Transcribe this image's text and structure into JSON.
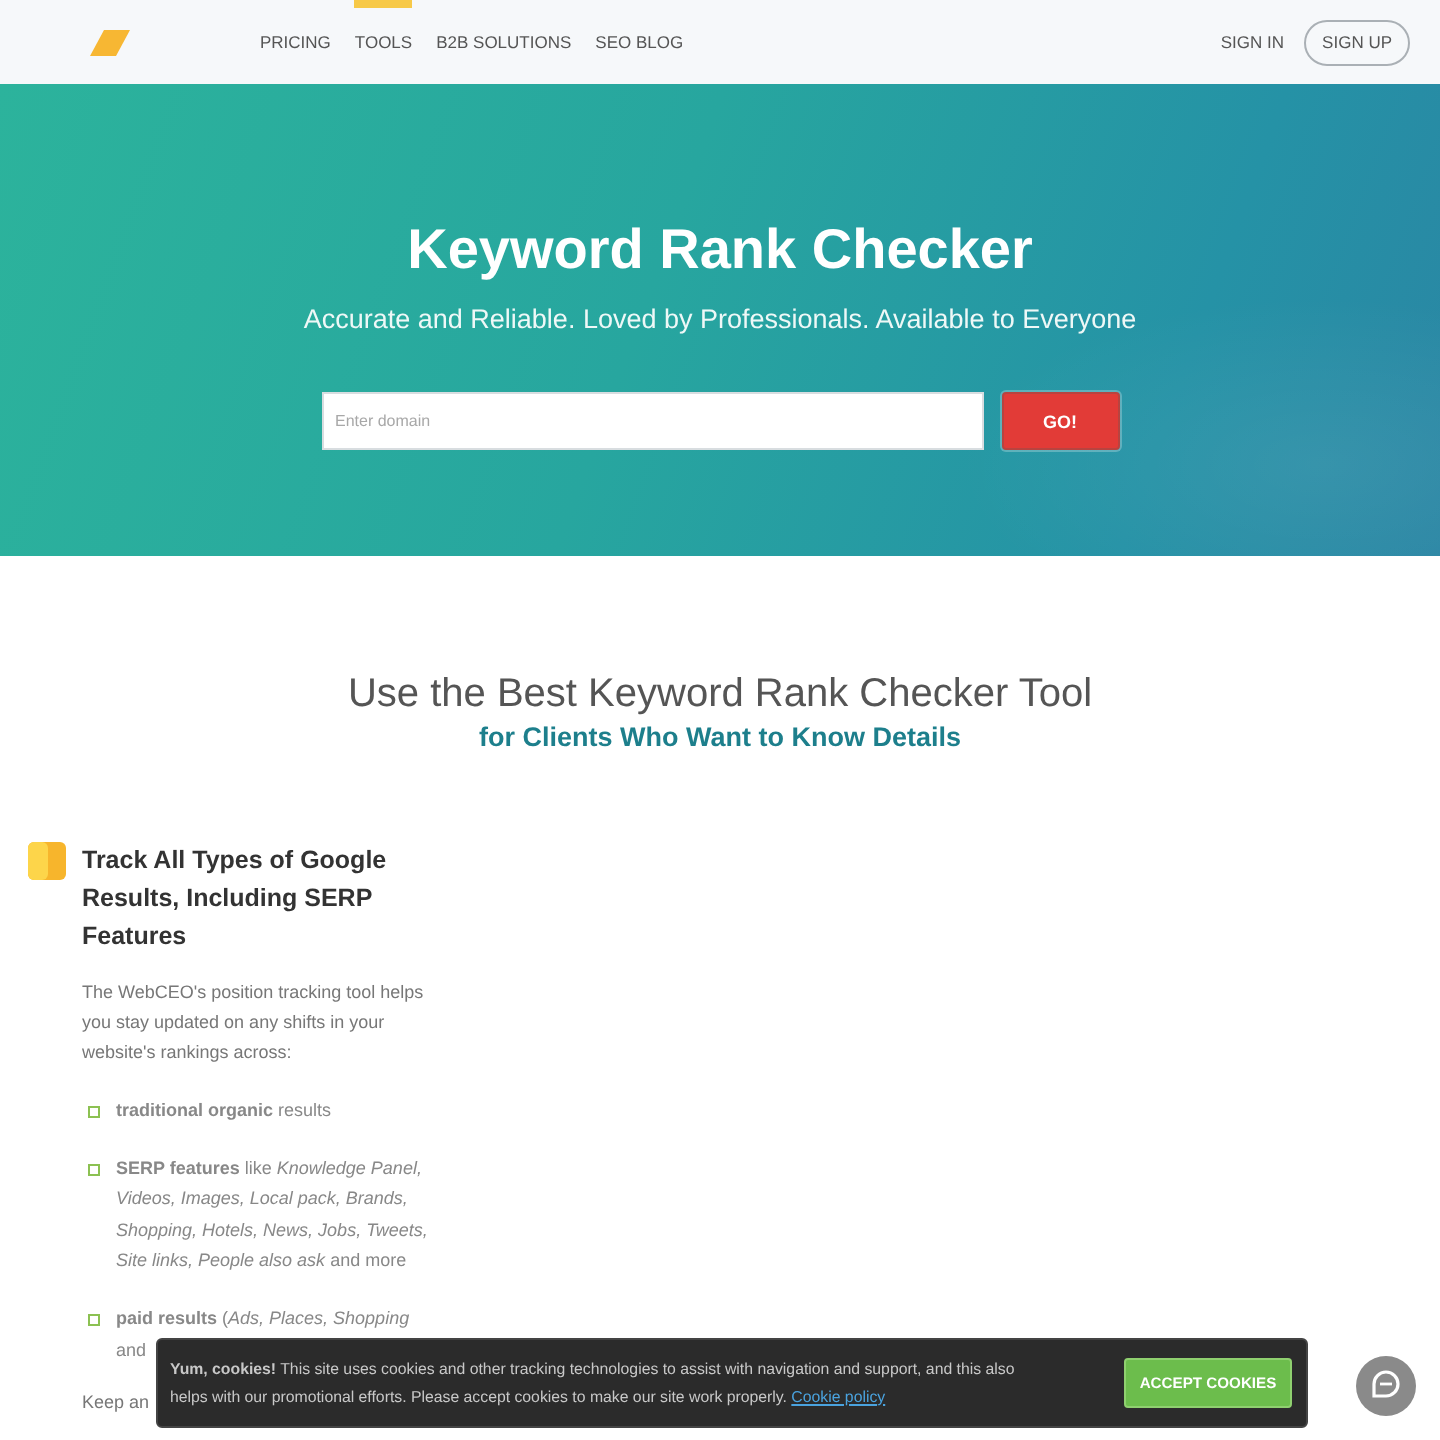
{
  "header": {
    "nav": [
      {
        "label": "PRICING",
        "selected": false
      },
      {
        "label": "TOOLS",
        "selected": true
      },
      {
        "label": "B2B SOLUTIONS",
        "selected": false
      },
      {
        "label": "SEO BLOG",
        "selected": false
      }
    ],
    "sign_in": "SIGN IN",
    "sign_up": "SIGN UP"
  },
  "hero": {
    "title": "Keyword Rank Checker",
    "subtitle": "Accurate and Reliable. Loved by Professionals. Available to Everyone",
    "search": {
      "placeholder": "Enter domain"
    },
    "button": "GO!"
  },
  "section": {
    "title": "Use the Best Keyword Rank Checker Tool",
    "subtitle": "for Clients Who Want to Know Details"
  },
  "feature": {
    "heading": "Track All Types of Google Results, Including SERP Features",
    "intro": "The WebCEO's position tracking tool helps you stay updated on any shifts in your website's rankings across:",
    "items": [
      "**traditional organic** results",
      "**SERP features** like *Knowledge Panel, Videos, Images, Local pack, Brands, Shopping, Hotels, News, Jobs, Tweets, Site links, People also ask* and more",
      "**paid results** (*Ads, Places, Shopping* and"
    ],
    "outro": "Keep an"
  },
  "cookie_banner": {
    "text": "**Yum, cookies!** This site uses cookies and other tracking technologies to assist with navigation and support, and this also helps with our promotional efforts. Please accept cookies to make our site work properly.",
    "link": "Cookie policy",
    "button": "ACCEPT COOKIES"
  }
}
